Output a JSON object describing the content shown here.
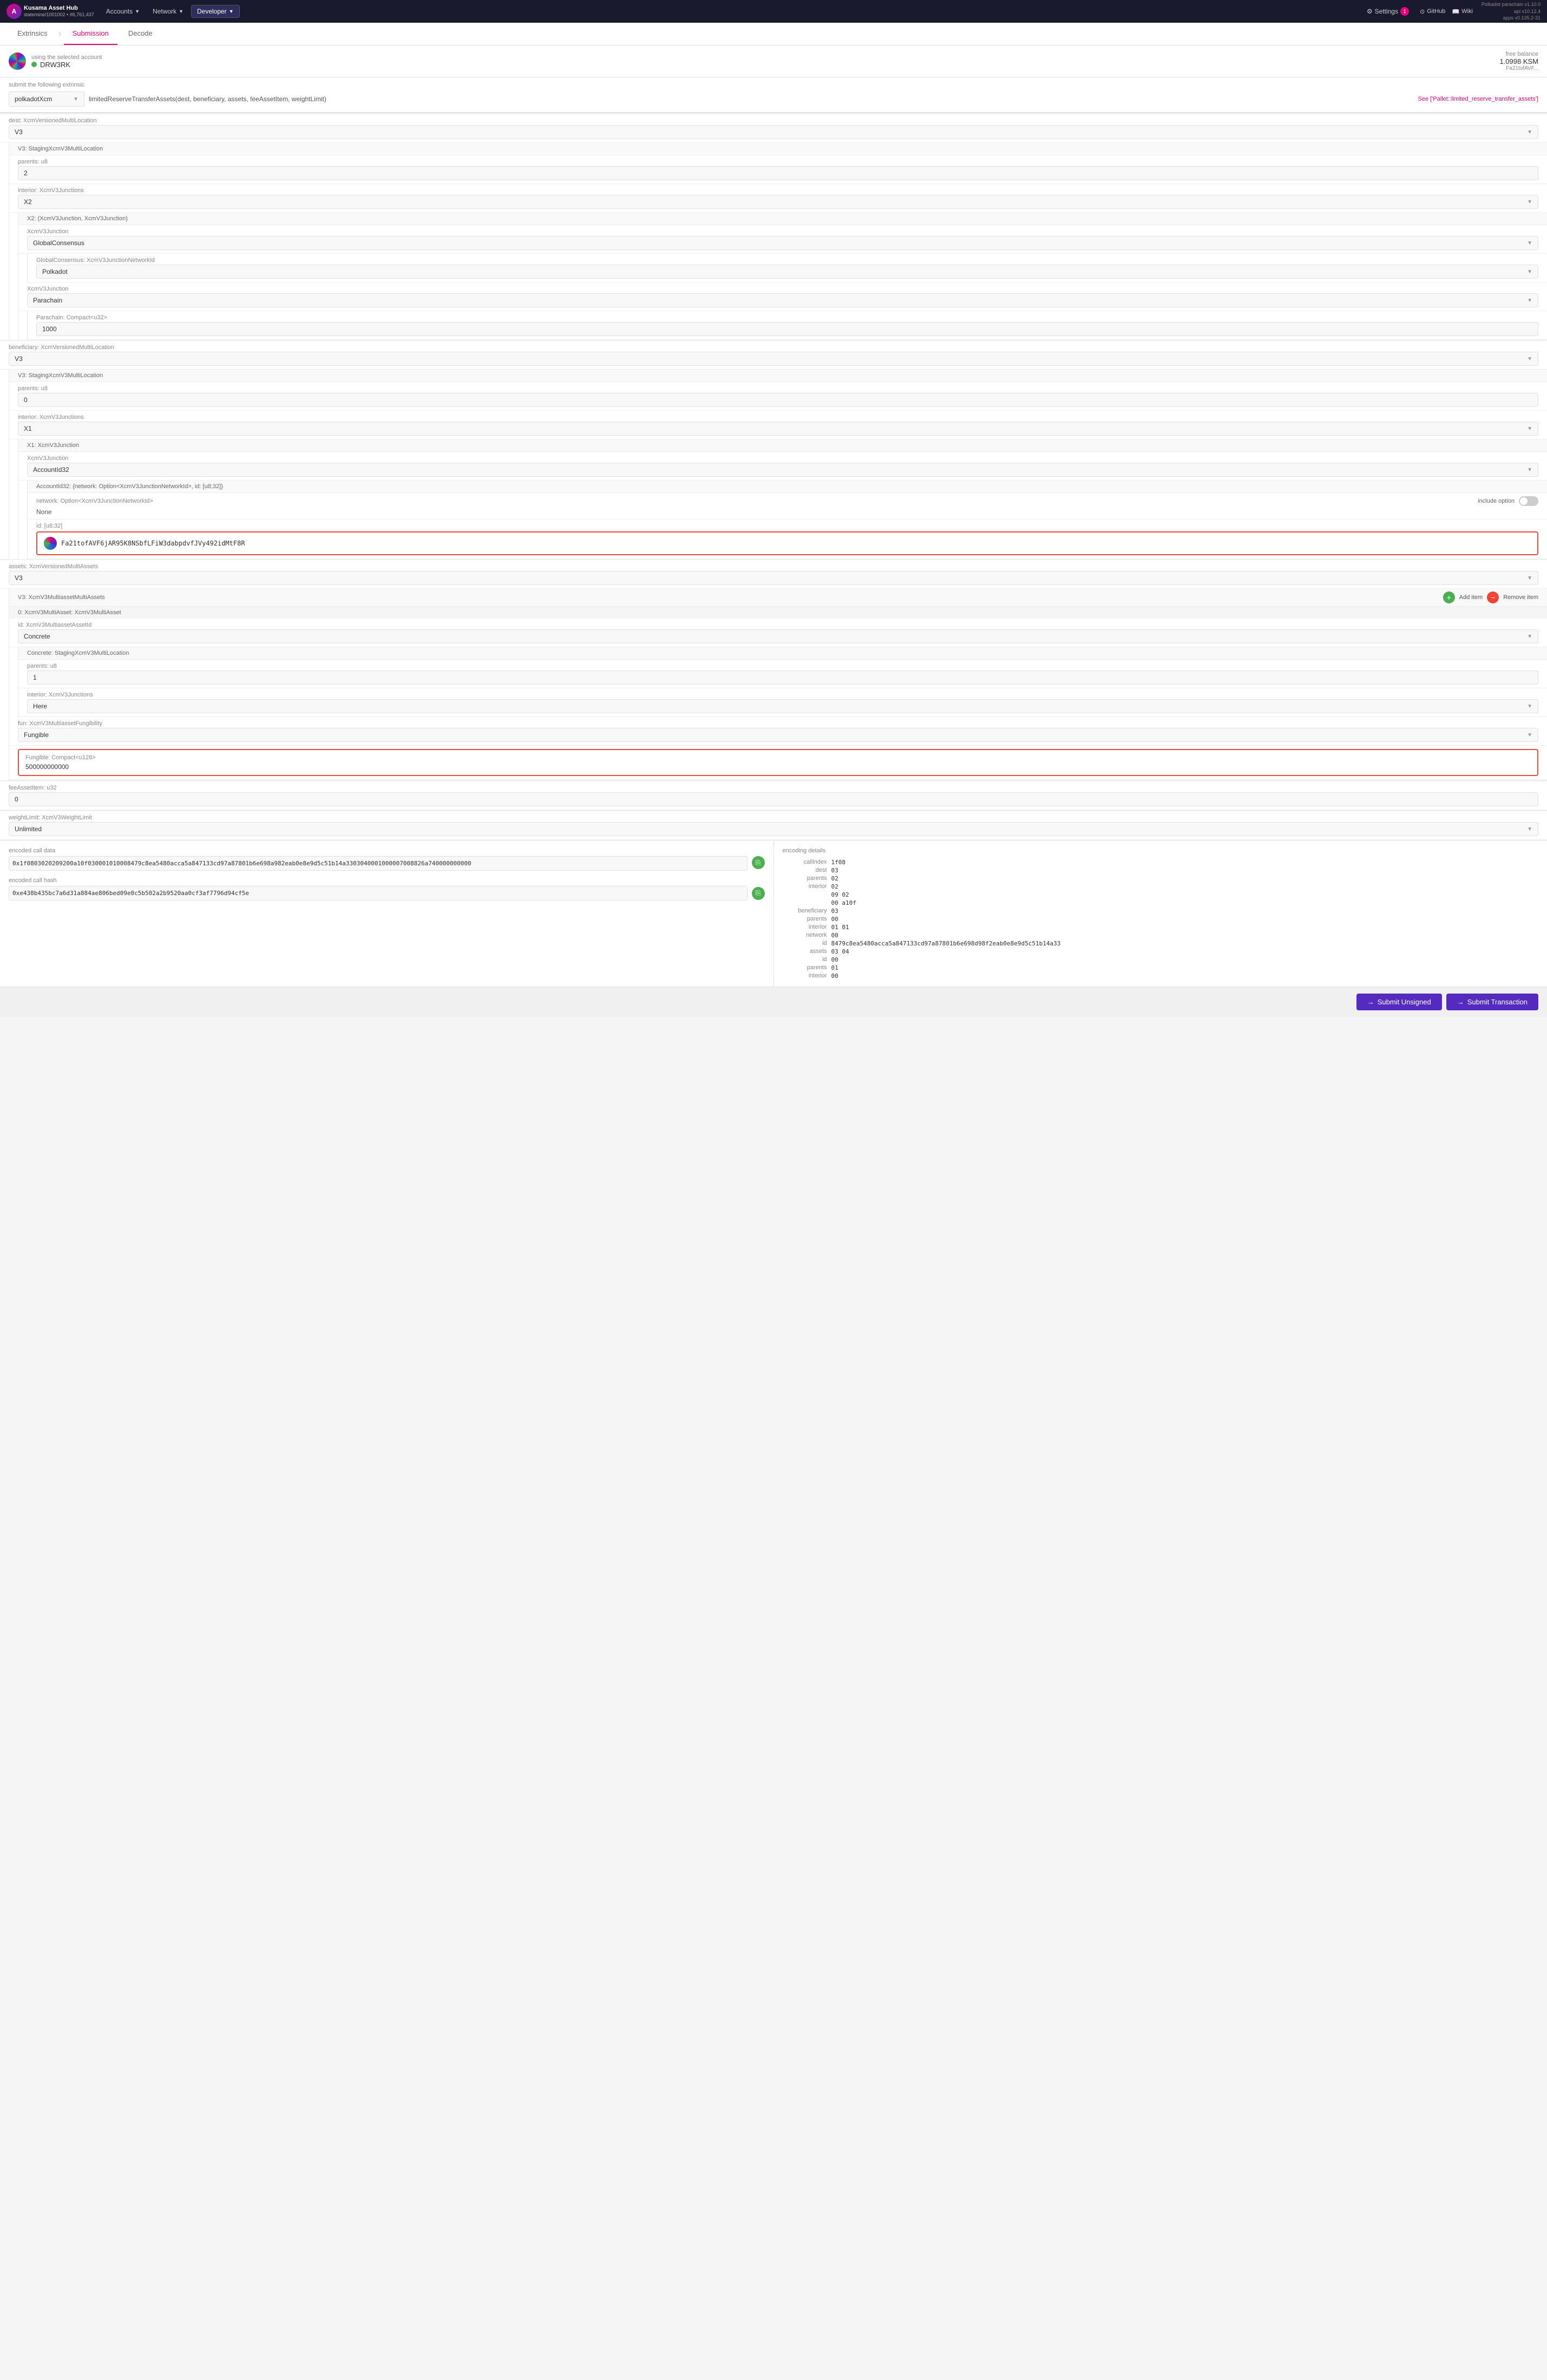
{
  "topNav": {
    "logo": "A",
    "appName": "Kusama Asset Hub",
    "appSub": "statemine/1001002 • #6,761,437",
    "accounts": "Accounts",
    "network": "Network",
    "developer": "Developer",
    "settings": "Settings",
    "settingsBadge": "1",
    "github": "GitHub",
    "wiki": "Wiki",
    "version": "Polkadot parachain v1.10.0\napi v10.12.4\napps v0.135.2-31"
  },
  "subNav": {
    "extrinsics": "Extrinsics",
    "submission": "Submission",
    "decode": "Decode"
  },
  "account": {
    "label": "using the selected account",
    "name": "DRW3RK",
    "freeBalanceLabel": "free balance",
    "balance": "1.0998 KSM",
    "address": "Fa21tofAVF..."
  },
  "extrinsic": {
    "submitLabel": "submit the following extrinsic",
    "pallet": "polkadotXcm",
    "method": "limitedReserveTransferAssets(dest, beneficiary, assets, feeAssetItem, weightLimit)",
    "seeLink": "See ['Pallet::limited_reserve_transfer_assets']"
  },
  "dest": {
    "label": "dest: XcmVersionedMultiLocation",
    "value": "V3",
    "v3Label": "V3: StagingXcmV3MultiLocation",
    "parents": {
      "label": "parents: u8",
      "value": "2"
    },
    "interior": {
      "label": "interior: XcmV3Junctions",
      "value": "X2"
    },
    "x2Label": "X2: (XcmV3Junction, XcmV3Junction)",
    "junction1": {
      "label": "XcmV3Junction",
      "value": "GlobalConsensus"
    },
    "globalConsensus": {
      "label": "GlobalConsensus: XcmV3JunctionNetworkId",
      "value": "Polkadot"
    },
    "junction2": {
      "label": "XcmV3Junction",
      "value": "Parachain"
    },
    "parachain": {
      "label": "Parachain: Compact<u32>",
      "value": "1000"
    }
  },
  "beneficiary": {
    "label": "beneficiary: XcmVersionedMultiLocation",
    "value": "V3",
    "v3Label": "V3: StagingXcmV3MultiLocation",
    "parents": {
      "label": "parents: u8",
      "value": "0"
    },
    "interior": {
      "label": "interior: XcmV3Junctions",
      "value": "X1"
    },
    "x1Label": "X1: XcmV3Junction",
    "junction": {
      "label": "XcmV3Junction",
      "value": "AccountId32"
    },
    "accountId32": {
      "label": "AccountId32: {network: Option<XcmV3JunctionNetworkId>, id: [u8;32]}",
      "networkLabel": "network: Option<XcmV3JunctionNetworkId>",
      "networkValue": "None",
      "includeOption": "include option",
      "idLabel": "id: [u8;32]",
      "idValue": "Fa21tofAVF6jAR95K8NSbfLFiW3dabpdvfJVy492idMtF8R"
    }
  },
  "assets": {
    "label": "assets: XcmVersionedMultiAssets",
    "value": "V3",
    "v3Label": "V3: XcmV3MultiassetMultiAssets",
    "addItem": "Add item",
    "removeItem": "Remove item",
    "item0": {
      "label": "0: XcmV3MultiAsset: XcmV3MultiAsset",
      "id": {
        "label": "id: XcmV3MultiassetAssetId",
        "value": "Concrete"
      },
      "concrete": {
        "label": "Concrete: StagingXcmV3MultiLocation",
        "parents": {
          "label": "parents: u8",
          "value": "1"
        },
        "interior": {
          "label": "interior: XcmV3Junctions",
          "value": "Here"
        }
      },
      "fun": {
        "label": "fun: XcmV3MultiassetFungibility",
        "value": "Fungible"
      },
      "fungible": {
        "label": "Fungible: Compact<u128>",
        "value": "500000000000"
      }
    }
  },
  "feeAssetItem": {
    "label": "feeAssetItem: u32",
    "value": "0"
  },
  "weightLimit": {
    "label": "weightLimit: XcmV3WeightLimit",
    "value": "Unlimited"
  },
  "encodedCallData": {
    "label": "encoded call data",
    "value": "0x1f0803020209200a10f030001010008479c8ea5480acca5a847133cd97a87801b6e698a982eab0e8e9d5c51b14a3303040001000007008826a740000000000"
  },
  "encodedCallHash": {
    "label": "encoded call hash",
    "value": "0xe438b435bc7a6d31a884ae806bed09e0c5b502a2b9520aa0cf3af7796d94cf5e"
  },
  "encodingDetails": {
    "title": "encoding details",
    "rows": [
      {
        "key": "callindex",
        "value": "1f08"
      },
      {
        "key": "dest",
        "value": "03"
      },
      {
        "key": "parents",
        "value": "02"
      },
      {
        "key": "interior",
        "value": "02"
      },
      {
        "key": "",
        "value": "09 02"
      },
      {
        "key": "",
        "value": "00 a10f"
      },
      {
        "key": "beneficiary",
        "value": "03"
      },
      {
        "key": "parents",
        "value": "00"
      },
      {
        "key": "interior",
        "value": "01 01"
      },
      {
        "key": "network",
        "value": "00"
      },
      {
        "key": "id",
        "value": "8479c8ea5480acca5a847133cd97a87801b6e698d98f2eab0e8e9d5c51b14a33"
      },
      {
        "key": "assets",
        "value": "03 04"
      },
      {
        "key": "id",
        "value": "00"
      },
      {
        "key": "parents",
        "value": "01"
      },
      {
        "key": "interior",
        "value": "00"
      }
    ]
  },
  "submitButtons": {
    "submitUnsigned": "Submit Unsigned",
    "submitTransaction": "Submit Transaction"
  }
}
